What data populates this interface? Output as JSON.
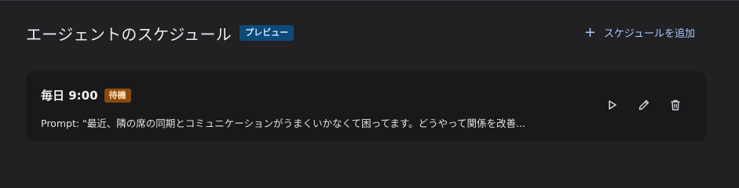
{
  "header": {
    "title": "エージェントのスケジュール",
    "badge": "プレビュー",
    "add_button_label": "スケジュールを追加"
  },
  "schedule": {
    "time": "毎日 9:00",
    "status": "待機",
    "prompt": "Prompt: \"最近、隣の席の同期とコミュニケーションがうまくいかなくて困ってます。どうやって関係を改善..."
  },
  "icons": {
    "add": "plus-icon",
    "run": "play-icon",
    "edit": "pencil-icon",
    "delete": "trash-icon"
  },
  "colors": {
    "background": "#212124",
    "card": "#19191b",
    "accent": "#a9c7ff",
    "preview_badge": "#0e4a78",
    "status_badge": "#8a4a0c"
  }
}
